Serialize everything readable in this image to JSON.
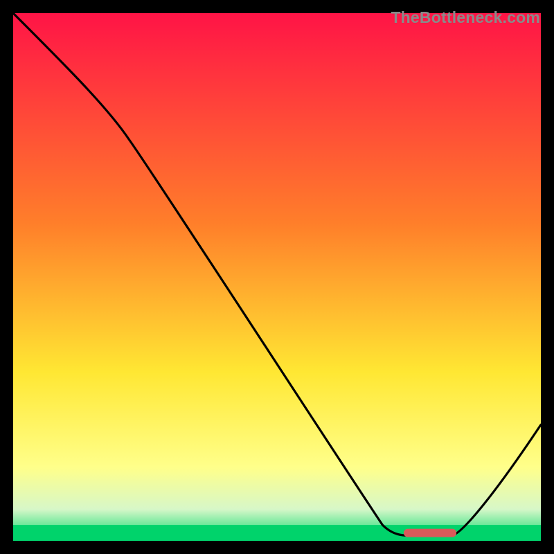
{
  "watermark": "TheBottleneck.com",
  "colors": {
    "top": "#ff1446",
    "mid_upper": "#ff7f2a",
    "mid": "#ffe733",
    "mid_lower": "#ffff8a",
    "green_pale": "#b7f2a5",
    "green": "#00d36b",
    "band_top": "#d7f7c8",
    "band_mid": "#6be89a",
    "band_bot": "#00c96a",
    "curve": "#000000",
    "marker": "#d85a5a",
    "background": "#000000"
  },
  "chart_data": {
    "type": "line",
    "title": "",
    "xlabel": "",
    "ylabel": "",
    "xlim": [
      0,
      100
    ],
    "ylim": [
      0,
      100
    ],
    "curve": [
      {
        "x": 0,
        "y": 100
      },
      {
        "x": 22,
        "y": 76
      },
      {
        "x": 70,
        "y": 3
      },
      {
        "x": 75,
        "y": 1
      },
      {
        "x": 83,
        "y": 1
      },
      {
        "x": 100,
        "y": 22
      }
    ],
    "optimum_band": {
      "x_start": 74,
      "x_end": 84,
      "y": 1.5
    },
    "gradient_bands": [
      {
        "y": 100,
        "color_key": "top"
      },
      {
        "y": 60,
        "color_key": "mid_upper"
      },
      {
        "y": 32,
        "color_key": "mid"
      },
      {
        "y": 14,
        "color_key": "mid_lower"
      },
      {
        "y": 6,
        "color_key": "band_top"
      },
      {
        "y": 3,
        "color_key": "band_mid"
      },
      {
        "y": 0,
        "color_key": "green"
      }
    ]
  }
}
